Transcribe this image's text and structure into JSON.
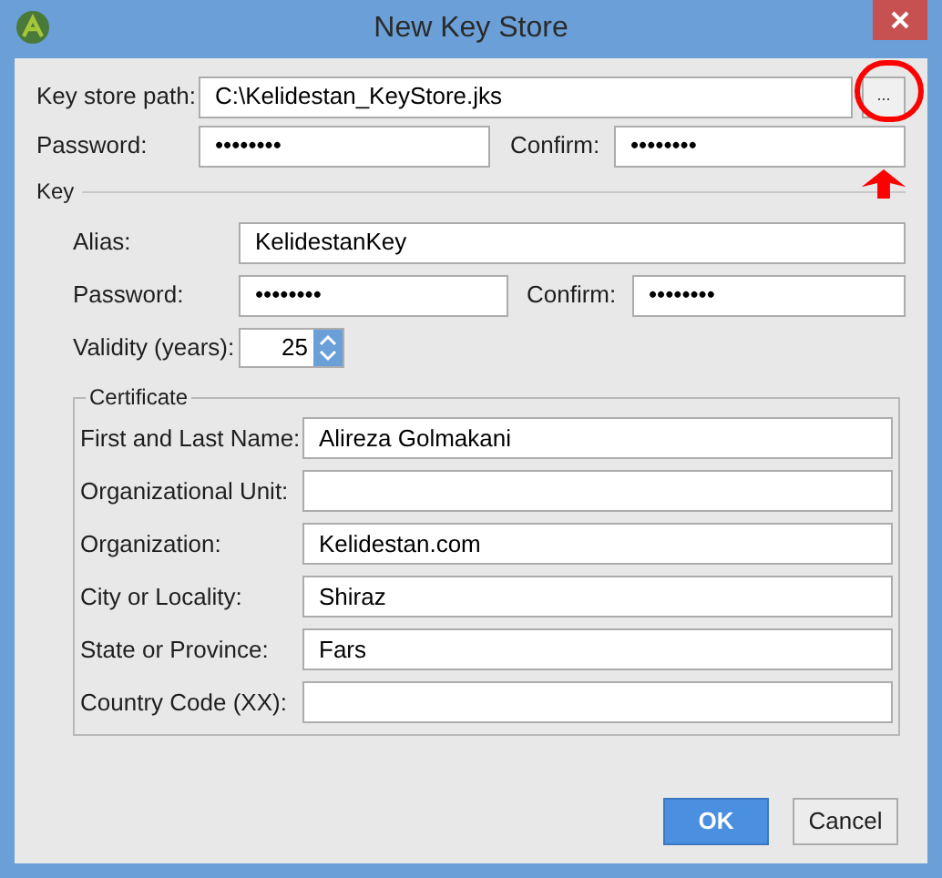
{
  "window": {
    "title": "New Key Store"
  },
  "keystore": {
    "path_label": "Key store path:",
    "path": "C:\\Kelidestan_KeyStore.jks",
    "browse": "...",
    "password_label": "Password:",
    "password": "••••••••",
    "confirm_label": "Confirm:",
    "confirm": "••••••••"
  },
  "key": {
    "title": "Key",
    "alias_label": "Alias:",
    "alias": "KelidestanKey",
    "password_label": "Password:",
    "password": "••••••••",
    "confirm_label": "Confirm:",
    "confirm": "••••••••",
    "validity_label": "Validity (years):",
    "validity": "25"
  },
  "certificate": {
    "title": "Certificate",
    "fields": [
      {
        "label": "First and Last Name:",
        "value": "Alireza Golmakani"
      },
      {
        "label": "Organizational Unit:"
      },
      {
        "label": "Organization:",
        "value": "Kelidestan.com"
      },
      {
        "label": "City or Locality:",
        "value": "Shiraz"
      },
      {
        "label": "State or Province:",
        "value": "Fars"
      },
      {
        "label": "Country Code (XX):"
      }
    ]
  },
  "buttons": [
    {
      "label": "OK",
      "kind": "primary"
    },
    {
      "label": "Cancel",
      "kind": "secondary"
    }
  ]
}
